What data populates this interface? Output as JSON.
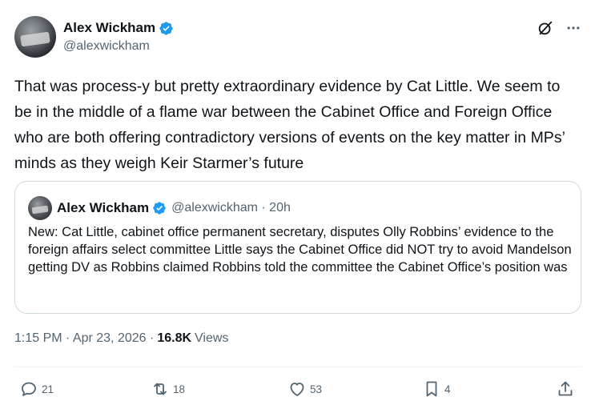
{
  "author": {
    "name": "Alex Wickham",
    "handle": "@alexwickham"
  },
  "tweet": {
    "text": "That was process-y but pretty extraordinary evidence by Cat Little. We seem to be in the middle of a flame war between the Cabinet Office and Foreign Office who are both offering contradictory versions of events on the key matter in MPs’ minds as they weigh Keir Starmer’s future"
  },
  "quote": {
    "name": "Alex Wickham",
    "handle_time": "@alexwickham · 20h",
    "text": "New: Cat Little, cabinet office permanent secretary, disputes Olly Robbins’ evidence to the foreign affairs select committee Little says the Cabinet Office did NOT try to avoid Mandelson getting DV as Robbins claimed  Robbins told the committee the Cabinet Office’s position was"
  },
  "meta": {
    "timestamp": "1:15 PM · Apr 23, 2026 ·",
    "views_count": "16.8K",
    "views_label": "Views"
  },
  "actions": {
    "replies": "21",
    "reposts": "18",
    "likes": "53",
    "bookmarks": "4"
  },
  "icons": {
    "verified": "verified-badge-icon",
    "grok": "grok-icon",
    "more": "more-icon",
    "reply": "reply-icon",
    "repost": "repost-icon",
    "like": "heart-icon",
    "bookmark": "bookmark-icon",
    "share": "share-icon"
  },
  "colors": {
    "verified_blue": "#1d9bf0",
    "text_primary": "#0f1419",
    "text_secondary": "#536471"
  }
}
